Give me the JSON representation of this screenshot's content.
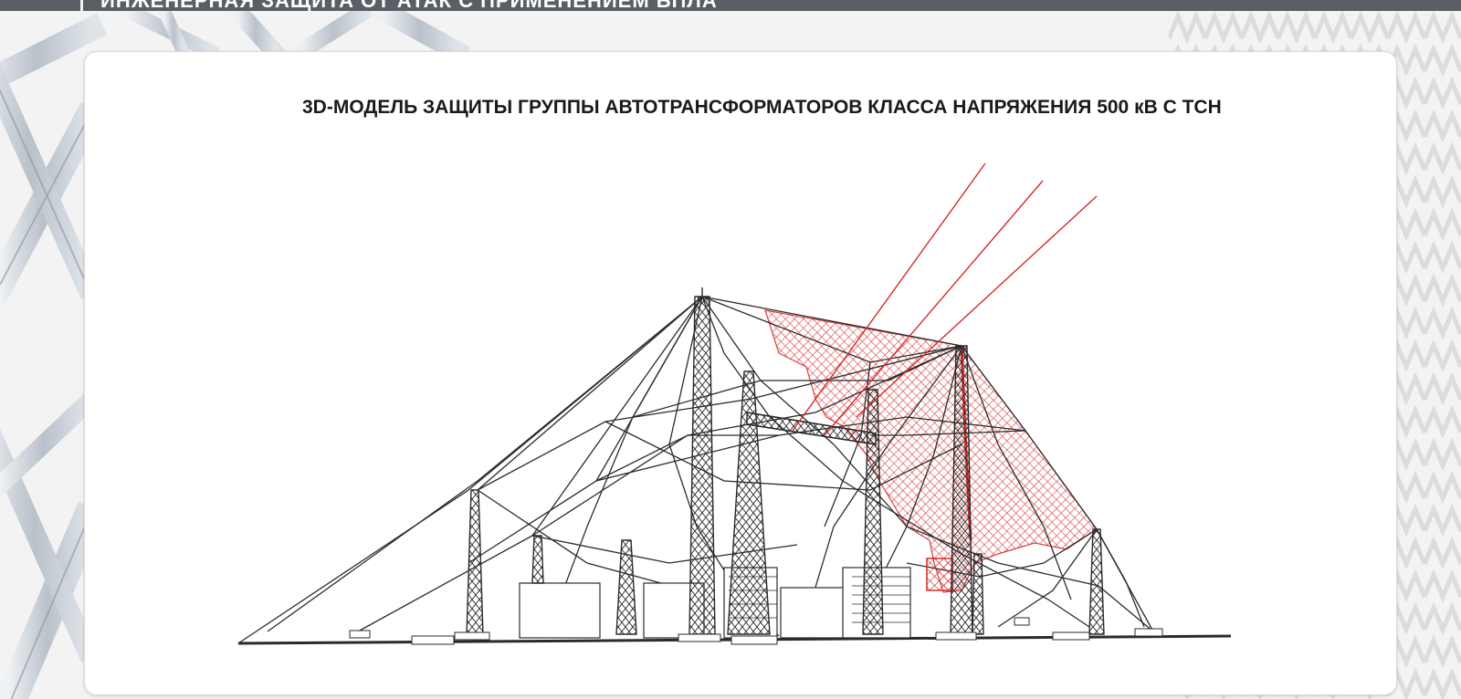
{
  "header": {
    "title": "ИНЖЕНЕРНАЯ ЗАЩИТА ОТ АТАК С ПРИМЕНЕНИЕМ БПЛА"
  },
  "card": {
    "title": "3D-МОДЕЛЬ ЗАЩИТЫ ГРУППЫ АВТОТРАНСФОРМАТОРОВ КЛАССА НАПРЯЖЕНИЯ 500 кВ С ТСН"
  },
  "colors": {
    "header_bar": "#5a5f66",
    "card_background": "#ffffff",
    "page_background": "#f3f3f3",
    "structure_lines": "#2b2b2b",
    "attack_lines": "#d42a2a",
    "net_damage": "#d42a2a"
  },
  "diagram": {
    "icons": [
      "lattice-tower",
      "protective-net-cable",
      "transformer-block",
      "drone-attack-trajectory",
      "damaged-net-area"
    ]
  }
}
